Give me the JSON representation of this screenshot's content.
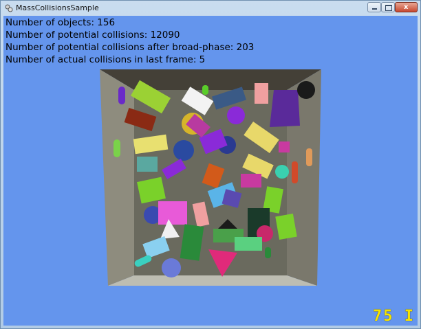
{
  "window": {
    "title": "MassCollisionsSample",
    "close_glyph": "x"
  },
  "stats": {
    "objects": "Number of objects: 156",
    "potential": "Number of potential collisions: 12090",
    "broadphase": "Number of potential collisions after broad-phase: 203",
    "actual": "Number of actual collisions in last frame: 5"
  },
  "fps": "75 I",
  "colors": {
    "background": "#6495ed",
    "fps_text": "#f6e400"
  }
}
